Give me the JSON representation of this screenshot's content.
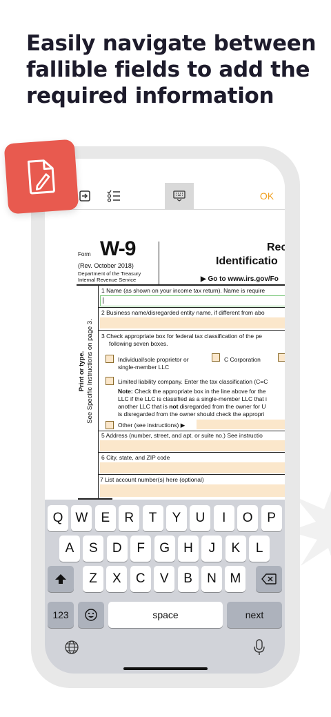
{
  "headline": {
    "line1": "Easily navigate between",
    "line2": "fallible fields to add the",
    "line3": "required information"
  },
  "colors": {
    "accent": "#e85a4f",
    "ok": "#f0a020",
    "field_fill": "#fbe7cb",
    "keyboard_bg": "#d1d3d9"
  },
  "toolbar": {
    "exit_icon": "exit-icon",
    "checklist_icon": "checklist-icon",
    "keyboard_icon": "keyboard-icon",
    "ok_label": "OK"
  },
  "form": {
    "form_word": "Form",
    "number": "W-9",
    "revision": "(Rev. October 2018)",
    "dept1": "Department of the Treasury",
    "dept2": "Internal Revenue Service",
    "title_partial": "Rec",
    "subtitle_partial": "Identificatio",
    "goto_partial": "▶ Go to www.irs.gov/Fo",
    "side_label1": "Print or type.",
    "side_label2": "See Specific Instructions on page 3.",
    "line1": "1  Name (as shown on your income tax return). Name is require",
    "line2": "2  Business name/disregarded entity name, if different from abo",
    "line3a": "3  Check appropriate box for federal tax classification of the pe",
    "line3b": "following seven boxes.",
    "opt_individual1": "Individual/sole proprietor or",
    "opt_individual2": "single-member LLC",
    "opt_ccorp": "C Corporation",
    "opt_llc": "Limited liability company. Enter the tax classification (C=C",
    "note_label": "Note:",
    "note1": " Check the appropriate box in the line above for the",
    "note2": "LLC if the LLC is classified as a single-member LLC that i",
    "note3a": "another LLC that is ",
    "note3b": "not",
    "note3c": " disregarded from the owner for U",
    "note4": "is disregarded from the owner should check the appropri",
    "opt_other": "Other (see instructions) ▶",
    "line5": "5  Address (number, street, and apt. or suite no.) See instructio",
    "line6": "6  City, state, and ZIP code",
    "line7": "7  List account number(s) here (optional)"
  },
  "keyboard": {
    "row1": [
      "Q",
      "W",
      "E",
      "R",
      "T",
      "Y",
      "U",
      "I",
      "O",
      "P"
    ],
    "row2": [
      "A",
      "S",
      "D",
      "F",
      "G",
      "H",
      "J",
      "K",
      "L"
    ],
    "row3": [
      "Z",
      "X",
      "C",
      "V",
      "B",
      "N",
      "M"
    ],
    "shift_icon": "shift-icon",
    "backspace_icon": "backspace-icon",
    "numbers_label": "123",
    "emoji_icon": "emoji-icon",
    "space_label": "space",
    "next_label": "next",
    "globe_icon": "globe-icon",
    "mic_icon": "microphone-icon"
  },
  "badge": {
    "icon": "document-edit-icon"
  }
}
